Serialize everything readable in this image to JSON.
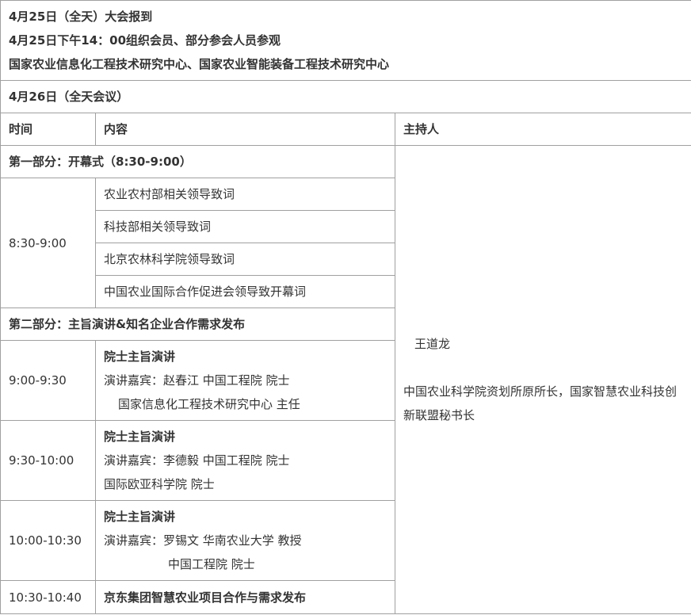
{
  "day1": {
    "line1": "4月25日（全天）大会报到",
    "line2": "4月25日下午14：00组织会员、部分参会人员参观",
    "line3": "国家农业信息化工程技术研究中心、国家农业智能装备工程技术研究中心"
  },
  "day2": {
    "title": "4月26日（全天会议）"
  },
  "header": {
    "time": "时间",
    "content": "内容",
    "host": "主持人"
  },
  "part1": {
    "title": "第一部分：开幕式（8:30-9:00）",
    "time": "8:30-9:00",
    "items": [
      "农业农村部相关领导致词",
      "科技部相关领导致词",
      "北京农林科学院领导致词",
      "中国农业国际合作促进会领导致开幕词"
    ]
  },
  "host": {
    "name": "王道龙",
    "title": "中国农业科学院资划所原所长，国家智慧农业科技创新联盟秘书长"
  },
  "part2": {
    "title": "第二部分：主旨演讲&知名企业合作需求发布",
    "sessions": [
      {
        "time": "9:00-9:30",
        "heading": "院士主旨演讲",
        "line1": "演讲嘉宾：赵春江   中国工程院  院士",
        "line2": "国家信息化工程技术研究中心 主任"
      },
      {
        "time": "9:30-10:00",
        "heading": "院士主旨演讲",
        "line1": "演讲嘉宾：李德毅  中国工程院 院士",
        "line2": "国际欧亚科学院 院士"
      },
      {
        "time": "10:00-10:30",
        "heading": "院士主旨演讲",
        "line1": "演讲嘉宾：罗锡文  华南农业大学 教授",
        "line2": "中国工程院 院士"
      }
    ],
    "last": {
      "time": "10:30-10:40",
      "content": "京东集团智慧农业项目合作与需求发布"
    }
  }
}
